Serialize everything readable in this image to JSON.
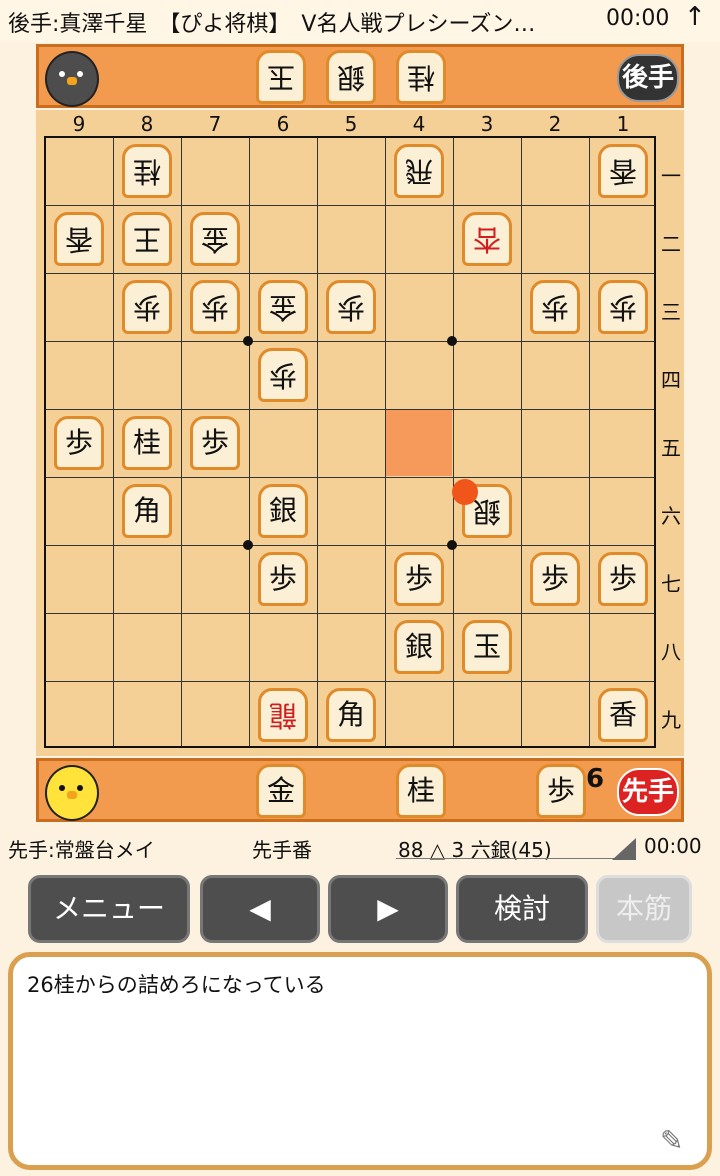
{
  "topbar": {
    "title": "後手:真澤千星　【ぴよ将棋】　V名人戦プレシーズン…",
    "time": "00:00",
    "arrow": "↑"
  },
  "gote_hand": {
    "badge": "後手",
    "pieces": [
      "玉",
      "銀",
      "桂"
    ]
  },
  "board": {
    "col_labels": [
      "9",
      "8",
      "7",
      "6",
      "5",
      "4",
      "3",
      "2",
      "1"
    ],
    "row_labels": [
      "一",
      "二",
      "三",
      "四",
      "五",
      "六",
      "七",
      "八",
      "九"
    ],
    "pieces": [
      {
        "row": 1,
        "col": 8,
        "ch": "桂",
        "rev": true,
        "red": false
      },
      {
        "row": 1,
        "col": 4,
        "ch": "飛",
        "rev": true,
        "red": false
      },
      {
        "row": 1,
        "col": 1,
        "ch": "香",
        "rev": true,
        "red": false
      },
      {
        "row": 2,
        "col": 9,
        "ch": "香",
        "rev": true,
        "red": false
      },
      {
        "row": 2,
        "col": 8,
        "ch": "王",
        "rev": true,
        "red": false
      },
      {
        "row": 2,
        "col": 7,
        "ch": "金",
        "rev": true,
        "red": false
      },
      {
        "row": 2,
        "col": 3,
        "ch": "杏",
        "rev": true,
        "red": true
      },
      {
        "row": 3,
        "col": 8,
        "ch": "歩",
        "rev": true,
        "red": false
      },
      {
        "row": 3,
        "col": 7,
        "ch": "歩",
        "rev": true,
        "red": false
      },
      {
        "row": 3,
        "col": 6,
        "ch": "金",
        "rev": true,
        "red": false
      },
      {
        "row": 3,
        "col": 5,
        "ch": "歩",
        "rev": true,
        "red": false
      },
      {
        "row": 3,
        "col": 2,
        "ch": "歩",
        "rev": true,
        "red": false
      },
      {
        "row": 3,
        "col": 1,
        "ch": "歩",
        "rev": true,
        "red": false
      },
      {
        "row": 4,
        "col": 6,
        "ch": "歩",
        "rev": true,
        "red": false
      },
      {
        "row": 5,
        "col": 9,
        "ch": "歩",
        "rev": false,
        "red": false
      },
      {
        "row": 5,
        "col": 8,
        "ch": "桂",
        "rev": false,
        "red": false
      },
      {
        "row": 5,
        "col": 7,
        "ch": "歩",
        "rev": false,
        "red": false
      },
      {
        "row": 6,
        "col": 8,
        "ch": "角",
        "rev": false,
        "red": false
      },
      {
        "row": 6,
        "col": 6,
        "ch": "銀",
        "rev": false,
        "red": false
      },
      {
        "row": 6,
        "col": 3,
        "ch": "銀",
        "rev": true,
        "red": false
      },
      {
        "row": 7,
        "col": 6,
        "ch": "歩",
        "rev": false,
        "red": false
      },
      {
        "row": 7,
        "col": 4,
        "ch": "歩",
        "rev": false,
        "red": false
      },
      {
        "row": 7,
        "col": 2,
        "ch": "歩",
        "rev": false,
        "red": false
      },
      {
        "row": 7,
        "col": 1,
        "ch": "歩",
        "rev": false,
        "red": false
      },
      {
        "row": 8,
        "col": 4,
        "ch": "銀",
        "rev": false,
        "red": false
      },
      {
        "row": 8,
        "col": 3,
        "ch": "玉",
        "rev": false,
        "red": false
      },
      {
        "row": 9,
        "col": 6,
        "ch": "龍",
        "rev": true,
        "red": true
      },
      {
        "row": 9,
        "col": 5,
        "ch": "角",
        "rev": false,
        "red": false
      },
      {
        "row": 9,
        "col": 1,
        "ch": "香",
        "rev": false,
        "red": false
      }
    ]
  },
  "sente_hand": {
    "badge": "先手",
    "pieces": [
      "金",
      "桂",
      "歩"
    ],
    "pawn_count": "6"
  },
  "info": {
    "player": "先手:常盤台メイ",
    "turn": "先手番",
    "move": "88 △ 3 六銀(45)",
    "time": "00:00"
  },
  "buttons": {
    "menu": "メニュー",
    "back": "◀",
    "forward": "▶",
    "analyze": "検討",
    "mainline": "本筋"
  },
  "comment": {
    "text": "26桂からの詰めろになっている",
    "edit_icon": "✎"
  },
  "colors": {
    "hand_bg": "#f29a4e",
    "board_bg": "#f4cf96",
    "highlight": "#f59a5a",
    "accent_red": "#d01e1e"
  }
}
